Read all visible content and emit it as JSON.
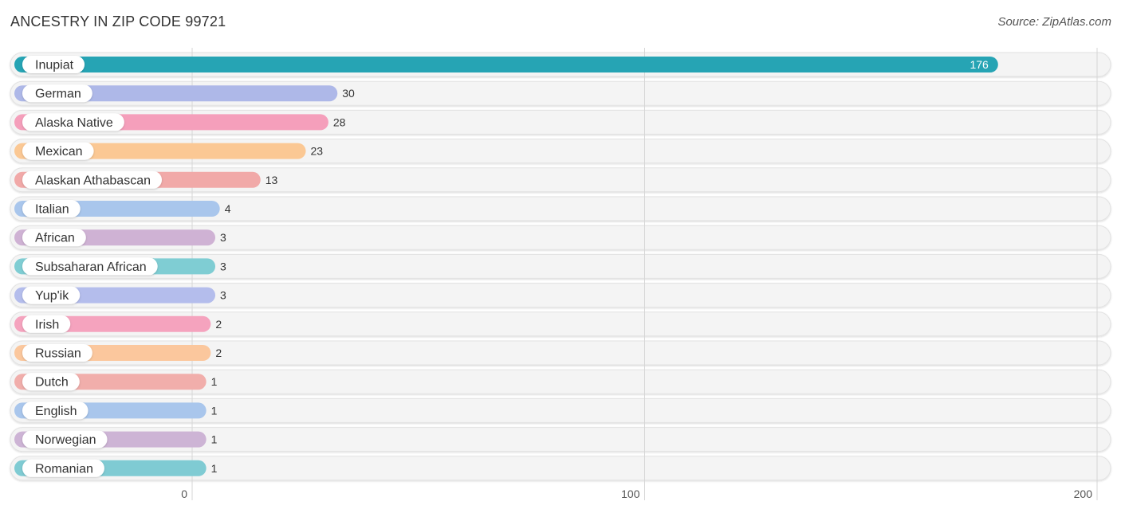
{
  "chart_data": {
    "type": "bar",
    "orientation": "horizontal",
    "title": "ANCESTRY IN ZIP CODE 99721",
    "source": "Source: ZipAtlas.com",
    "xlabel": "",
    "ylabel": "",
    "xlim": [
      0,
      200
    ],
    "xticks": [
      0,
      100,
      200
    ],
    "grid": true,
    "categories": [
      "Inupiat",
      "German",
      "Alaska Native",
      "Mexican",
      "Alaskan Athabascan",
      "Italian",
      "African",
      "Subsaharan African",
      "Yup'ik",
      "Irish",
      "Russian",
      "Dutch",
      "English",
      "Norwegian",
      "Romanian"
    ],
    "values": [
      176,
      30,
      28,
      23,
      13,
      4,
      3,
      3,
      3,
      2,
      2,
      1,
      1,
      1,
      1
    ],
    "colors": [
      "#26a4b4",
      "#aeb8e8",
      "#f59fbb",
      "#fbc894",
      "#f1a9a8",
      "#a9c6ec",
      "#cfb2d4",
      "#7fcdd3",
      "#b4bdec",
      "#f5a3be",
      "#fbc79d",
      "#f1aeab",
      "#a9c6ec",
      "#cdb4d5",
      "#7fcbd3"
    ]
  }
}
